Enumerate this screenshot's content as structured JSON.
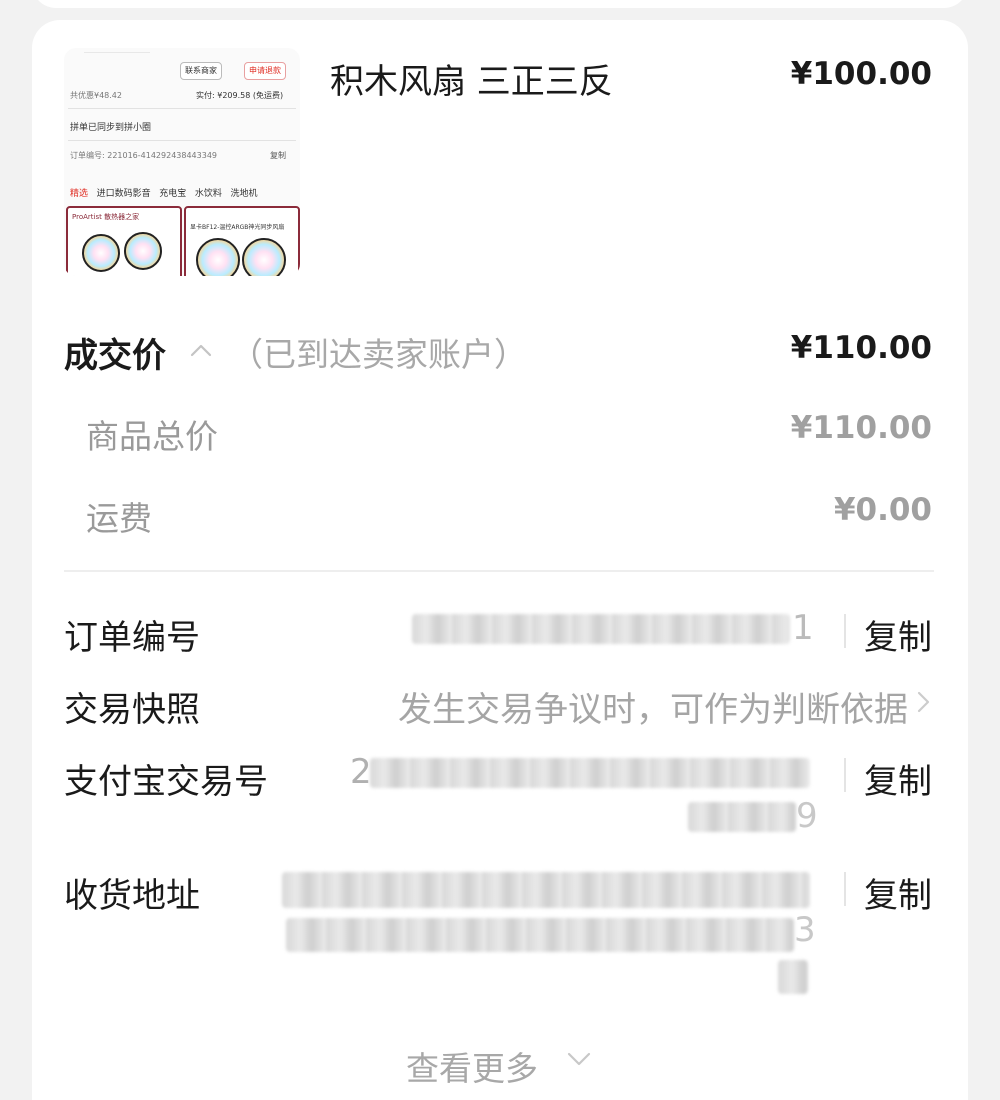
{
  "product": {
    "title": "积木风扇 三正三反",
    "price": "¥100.00",
    "thumbnail": {
      "contact_label": "联系商家",
      "refund_label": "申请退款",
      "discount_text": "共优惠¥48.42",
      "paid_text": "实付: ¥209.58 (免运费)",
      "sync_text": "拼单已同步到拼小圈",
      "order_no_text": "订单编号: 221016-414292438443349",
      "copy_label": "复制",
      "tabs": [
        "精选",
        "进口数码影音",
        "充电宝",
        "水饮料",
        "洗地机"
      ],
      "promo_left": "ProArtist 散热器之家",
      "promo_right": "显卡BF12-温控ARGB神光同步风扇"
    }
  },
  "pricing": {
    "deal_label": "成交价",
    "deal_note": "（已到达卖家账户）",
    "deal_price": "¥110.00",
    "rows": [
      {
        "label": "商品总价",
        "value": "¥110.00"
      },
      {
        "label": "运费",
        "value": "¥0.00"
      }
    ]
  },
  "order_info": {
    "order_number": {
      "label": "订单编号",
      "visible_tail": "1",
      "copy_label": "复制"
    },
    "snapshot": {
      "label": "交易快照",
      "value": "发生交易争议时，可作为判断依据"
    },
    "alipay": {
      "label": "支付宝交易号",
      "visible_head": "2",
      "visible_tail": "9",
      "copy_label": "复制"
    },
    "address": {
      "label": "收货地址",
      "visible_tail": "3",
      "copy_label": "复制"
    }
  },
  "footer": {
    "more_label": "查看更多"
  },
  "icons": {
    "expand_up": "chevron-up-icon",
    "snapshot_arrow": "chevron-right-icon",
    "more_arrow": "chevron-down-icon"
  },
  "colors": {
    "primary_text": "#1a1a1a",
    "secondary_text": "#a8a8a8",
    "background": "#f2f2f2",
    "card": "#ffffff",
    "accent_red": "#e02e24"
  }
}
